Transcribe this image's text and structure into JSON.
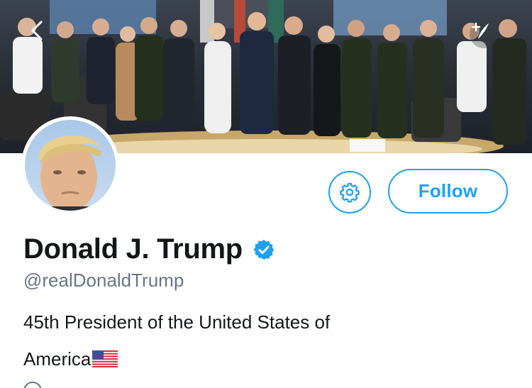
{
  "header": {
    "back_icon": "chevron-left-icon",
    "compose_icon": "compose-tweet-icon"
  },
  "profile": {
    "name": "Donald J. Trump",
    "verified_icon": "verified-badge-icon",
    "handle": "@realDonaldTrump",
    "bio_line1": "45th President of the United States of",
    "bio_line2": "America",
    "bio_flag_icon": "us-flag-icon"
  },
  "actions": {
    "settings_icon": "gear-icon",
    "follow_label": "Follow"
  },
  "colors": {
    "accent": "#1da1f2",
    "text_primary": "#14171a",
    "text_secondary": "#657786"
  }
}
